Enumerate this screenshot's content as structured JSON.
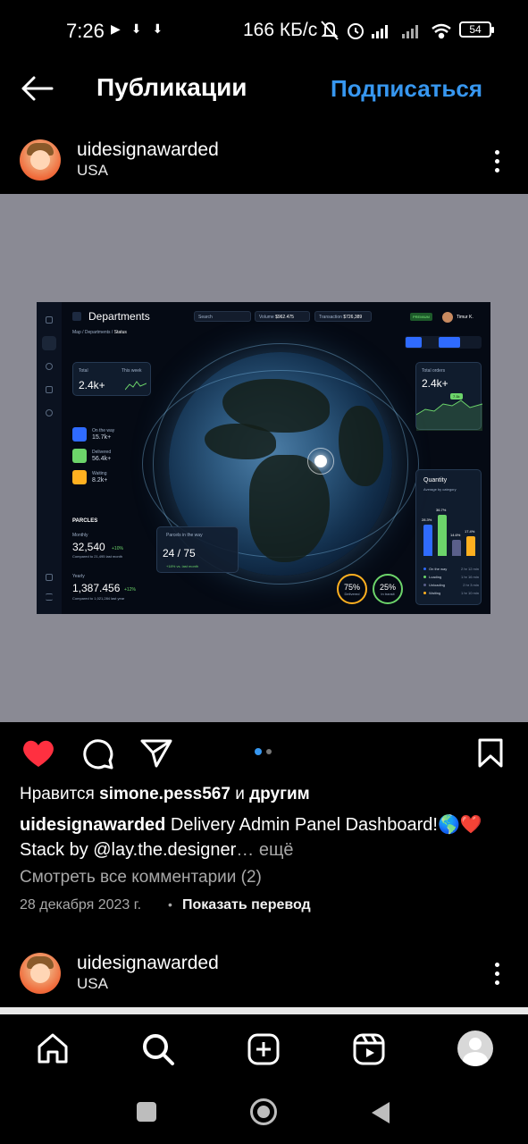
{
  "status_bar": {
    "time": "7:26",
    "speed": "166 КБ/с",
    "battery": "54"
  },
  "top_bar": {
    "title": "Публикации",
    "follow_label": "Подписаться"
  },
  "post": {
    "username": "uidesignawarded",
    "location": "USA",
    "likes_prefix": "Нравится ",
    "likes_user": "simone.pess567",
    "likes_suffix": " и ",
    "likes_others": "другим",
    "caption_user": "uidesignawarded",
    "caption_text": " Delivery Admin Panel Dashboard!🌎❤️ Stack by @lay.the.designer",
    "caption_more_ellipsis": "…",
    "caption_more": " ещё",
    "view_comments": "Смотреть все комментарии (2)",
    "date": "28 декабря 2023 г.",
    "separator": "•",
    "translate": "Показать перевод",
    "carousel": {
      "count": 2,
      "active": 1
    }
  },
  "dashboard": {
    "title": "Departments",
    "breadcrumb": [
      "Map",
      "Departments",
      "Status"
    ],
    "search_placeholder": "Search",
    "volume_label": "Volume",
    "volume_value": "$962.475",
    "trans_label": "Transaction",
    "trans_value": "$726,389",
    "premium": "PREMIUM",
    "user": "Timur K.",
    "total_label": "Total",
    "total_period": "This week",
    "total_value": "2.4k+",
    "total_orders_label": "Total orders",
    "total_orders_value": "2.4k+",
    "total_orders_badge": "7.1k",
    "statuses": [
      {
        "label": "On the way",
        "value": "15.7k+",
        "color": "#2f6bff"
      },
      {
        "label": "Delivered",
        "value": "56.4k+",
        "color": "#6cd46a"
      },
      {
        "label": "Waiting",
        "value": "8.2k+",
        "color": "#ffb020"
      }
    ],
    "parcels_title": "PARCLES",
    "monthly_label": "Monthly",
    "monthly_value": "32,540",
    "monthly_change": "+10%",
    "monthly_note": "Compared to 21,495 last month",
    "yearly_label": "Yearly",
    "yearly_value": "1,387.456",
    "yearly_change": "+12%",
    "yearly_note": "Compared to 1,021,284 last year",
    "parcels_card_label": "Parcels in the way",
    "parcels_card_value": "24 / 75",
    "parcels_card_note": "+18% vs. last month",
    "ring1_value": "75%",
    "ring1_label": "Delivered",
    "ring2_value": "25%",
    "ring2_label": "In transit",
    "quantity": {
      "title": "Quantity",
      "subtitle": "Average by category",
      "bars": [
        {
          "label": "28.3%",
          "value": 28.3,
          "color": "#2f6bff"
        },
        {
          "label": "36.7%",
          "value": 36.7,
          "color": "#6cd46a"
        },
        {
          "label": "14.6%",
          "value": 14.6,
          "color": "#5a5f8a"
        },
        {
          "label": "17.4%",
          "value": 17.4,
          "color": "#ffb020"
        }
      ],
      "legend": [
        {
          "label": "On the way",
          "value": "2 hr 12 min",
          "color": "#2f6bff"
        },
        {
          "label": "Loading",
          "value": "1 hr 16 min",
          "color": "#6cd46a"
        },
        {
          "label": "Unloading",
          "value": "2 hr 3 min",
          "color": "#5a5f8a"
        },
        {
          "label": "Waiting",
          "value": "1 hr 10 min",
          "color": "#ffb020"
        }
      ]
    }
  },
  "post2": {
    "username": "uidesignawarded",
    "location": "USA"
  },
  "colors": {
    "accent": "#3797f0",
    "like": "#ff3040",
    "media_bg": "#8a8a94"
  }
}
